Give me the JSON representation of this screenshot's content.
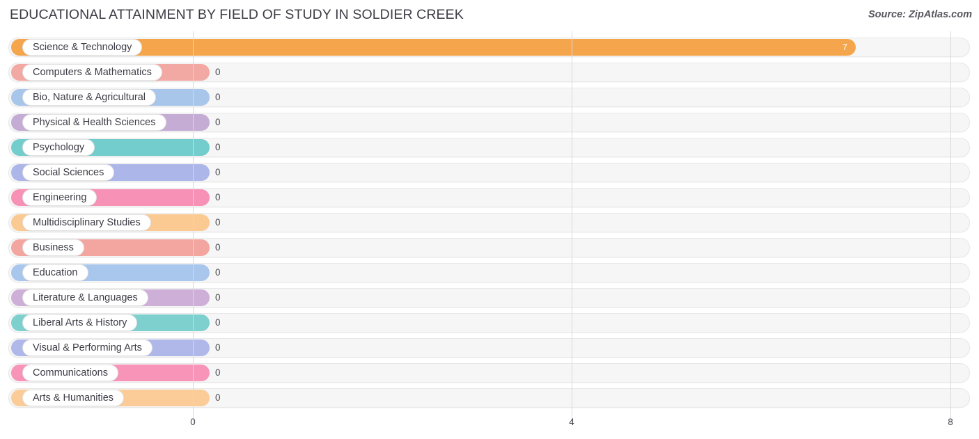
{
  "header": {
    "title": "EDUCATIONAL ATTAINMENT BY FIELD OF STUDY IN SOLDIER CREEK",
    "source": "Source: ZipAtlas.com"
  },
  "chart_data": {
    "type": "bar",
    "orientation": "horizontal",
    "title": "EDUCATIONAL ATTAINMENT BY FIELD OF STUDY IN SOLDIER CREEK",
    "xlabel": "",
    "ylabel": "",
    "xlim": [
      0,
      8.2
    ],
    "xticks": [
      0,
      4,
      8
    ],
    "xtick_labels": [
      "0",
      "4",
      "8"
    ],
    "grid": true,
    "legend": "none",
    "categories": [
      "Science & Technology",
      "Computers & Mathematics",
      "Bio, Nature & Agricultural",
      "Physical & Health Sciences",
      "Psychology",
      "Social Sciences",
      "Engineering",
      "Multidisciplinary Studies",
      "Business",
      "Education",
      "Literature & Languages",
      "Liberal Arts & History",
      "Visual & Performing Arts",
      "Communications",
      "Arts & Humanities"
    ],
    "values": [
      7,
      0,
      0,
      0,
      0,
      0,
      0,
      0,
      0,
      0,
      0,
      0,
      0,
      0,
      0
    ],
    "value_labels": [
      "7",
      "0",
      "0",
      "0",
      "0",
      "0",
      "0",
      "0",
      "0",
      "0",
      "0",
      "0",
      "0",
      "0",
      "0"
    ],
    "colors": [
      "#f5a54c",
      "#f3a9a3",
      "#a8c5ea",
      "#c5acd4",
      "#74cdcd",
      "#adb6e8",
      "#f791b6",
      "#fbc992",
      "#f3a6a0",
      "#a9c6ec",
      "#cdafd8",
      "#7ed0cf",
      "#b0b8e9",
      "#f794b8",
      "#fbcc98"
    ]
  }
}
